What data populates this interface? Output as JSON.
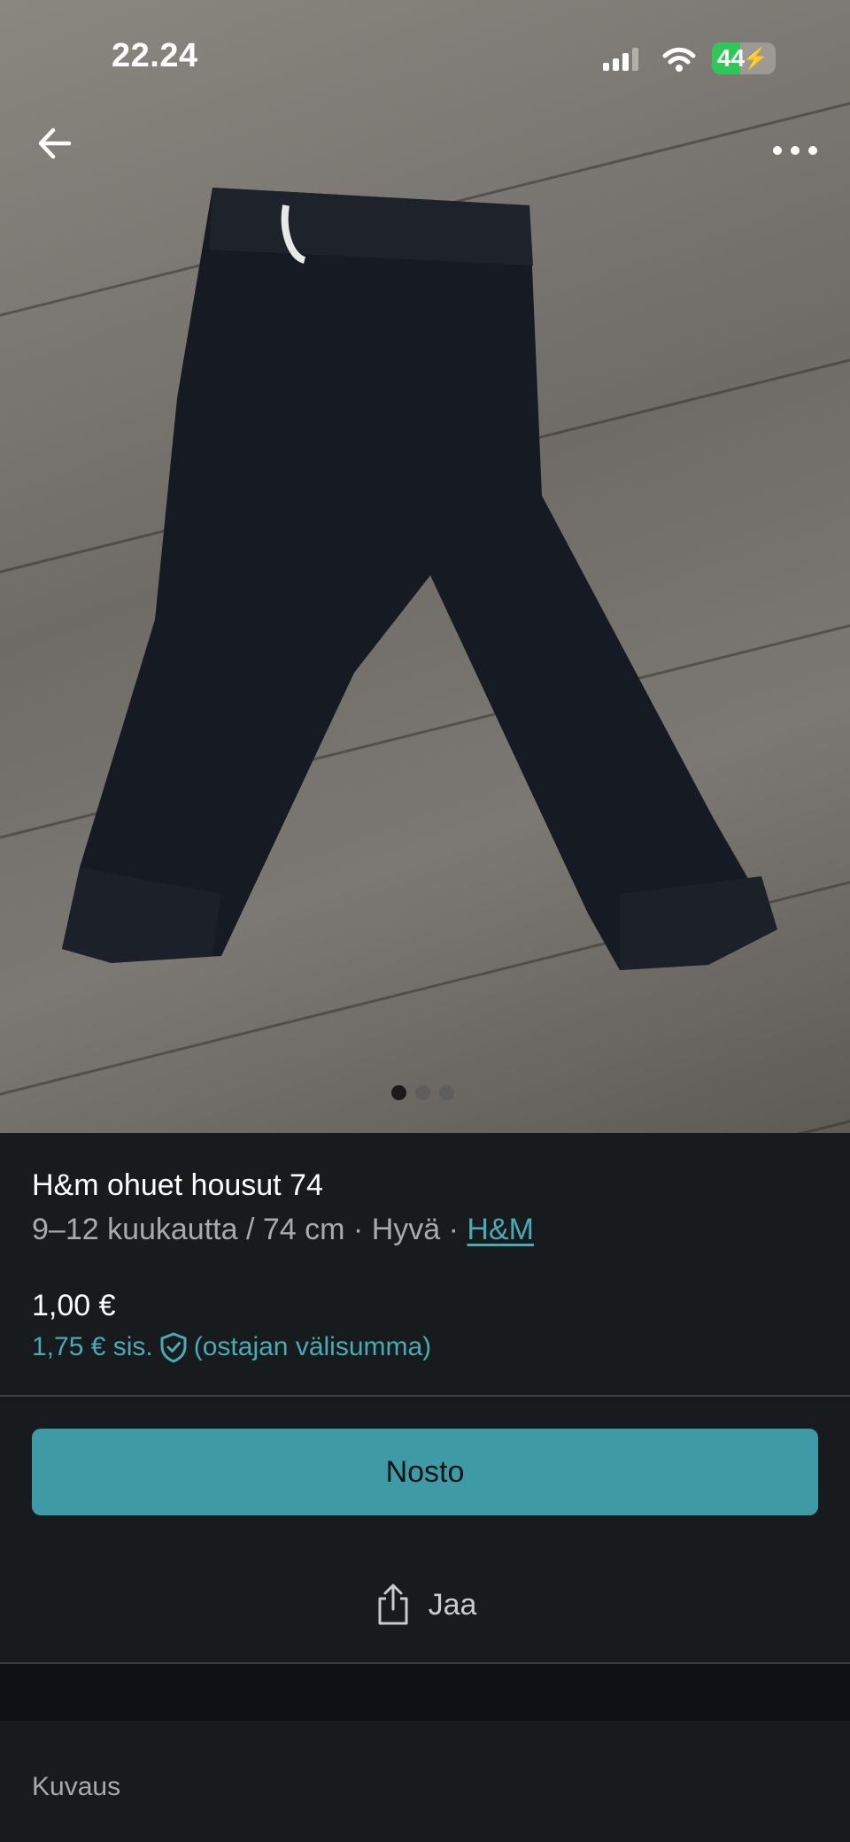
{
  "status_bar": {
    "time": "22.24",
    "battery": "44",
    "battery_level": 0.44
  },
  "photo": {
    "pager": {
      "count": 3,
      "active": 0
    }
  },
  "item": {
    "title": "H&m ohuet housut 74",
    "meta_size": "9–12 kuukautta / 74 cm",
    "separator": "·",
    "meta_condition": "Hyvä",
    "brand": "H&M",
    "price": "1,00 €",
    "buyer_price": "1,75 € sis.",
    "buyer_price_note": "(ostajan välisumma)"
  },
  "actions": {
    "buy_label": "Nosto",
    "share_label": "Jaa"
  },
  "description": {
    "label": "Kuvaus"
  },
  "colors": {
    "accent": "#3e9ba6",
    "link": "#4aaab4",
    "background": "#181b1d"
  },
  "icons": [
    "back-arrow-icon",
    "more-icon",
    "signal-icon",
    "wifi-icon",
    "battery-icon",
    "shield-check-icon",
    "share-icon"
  ]
}
